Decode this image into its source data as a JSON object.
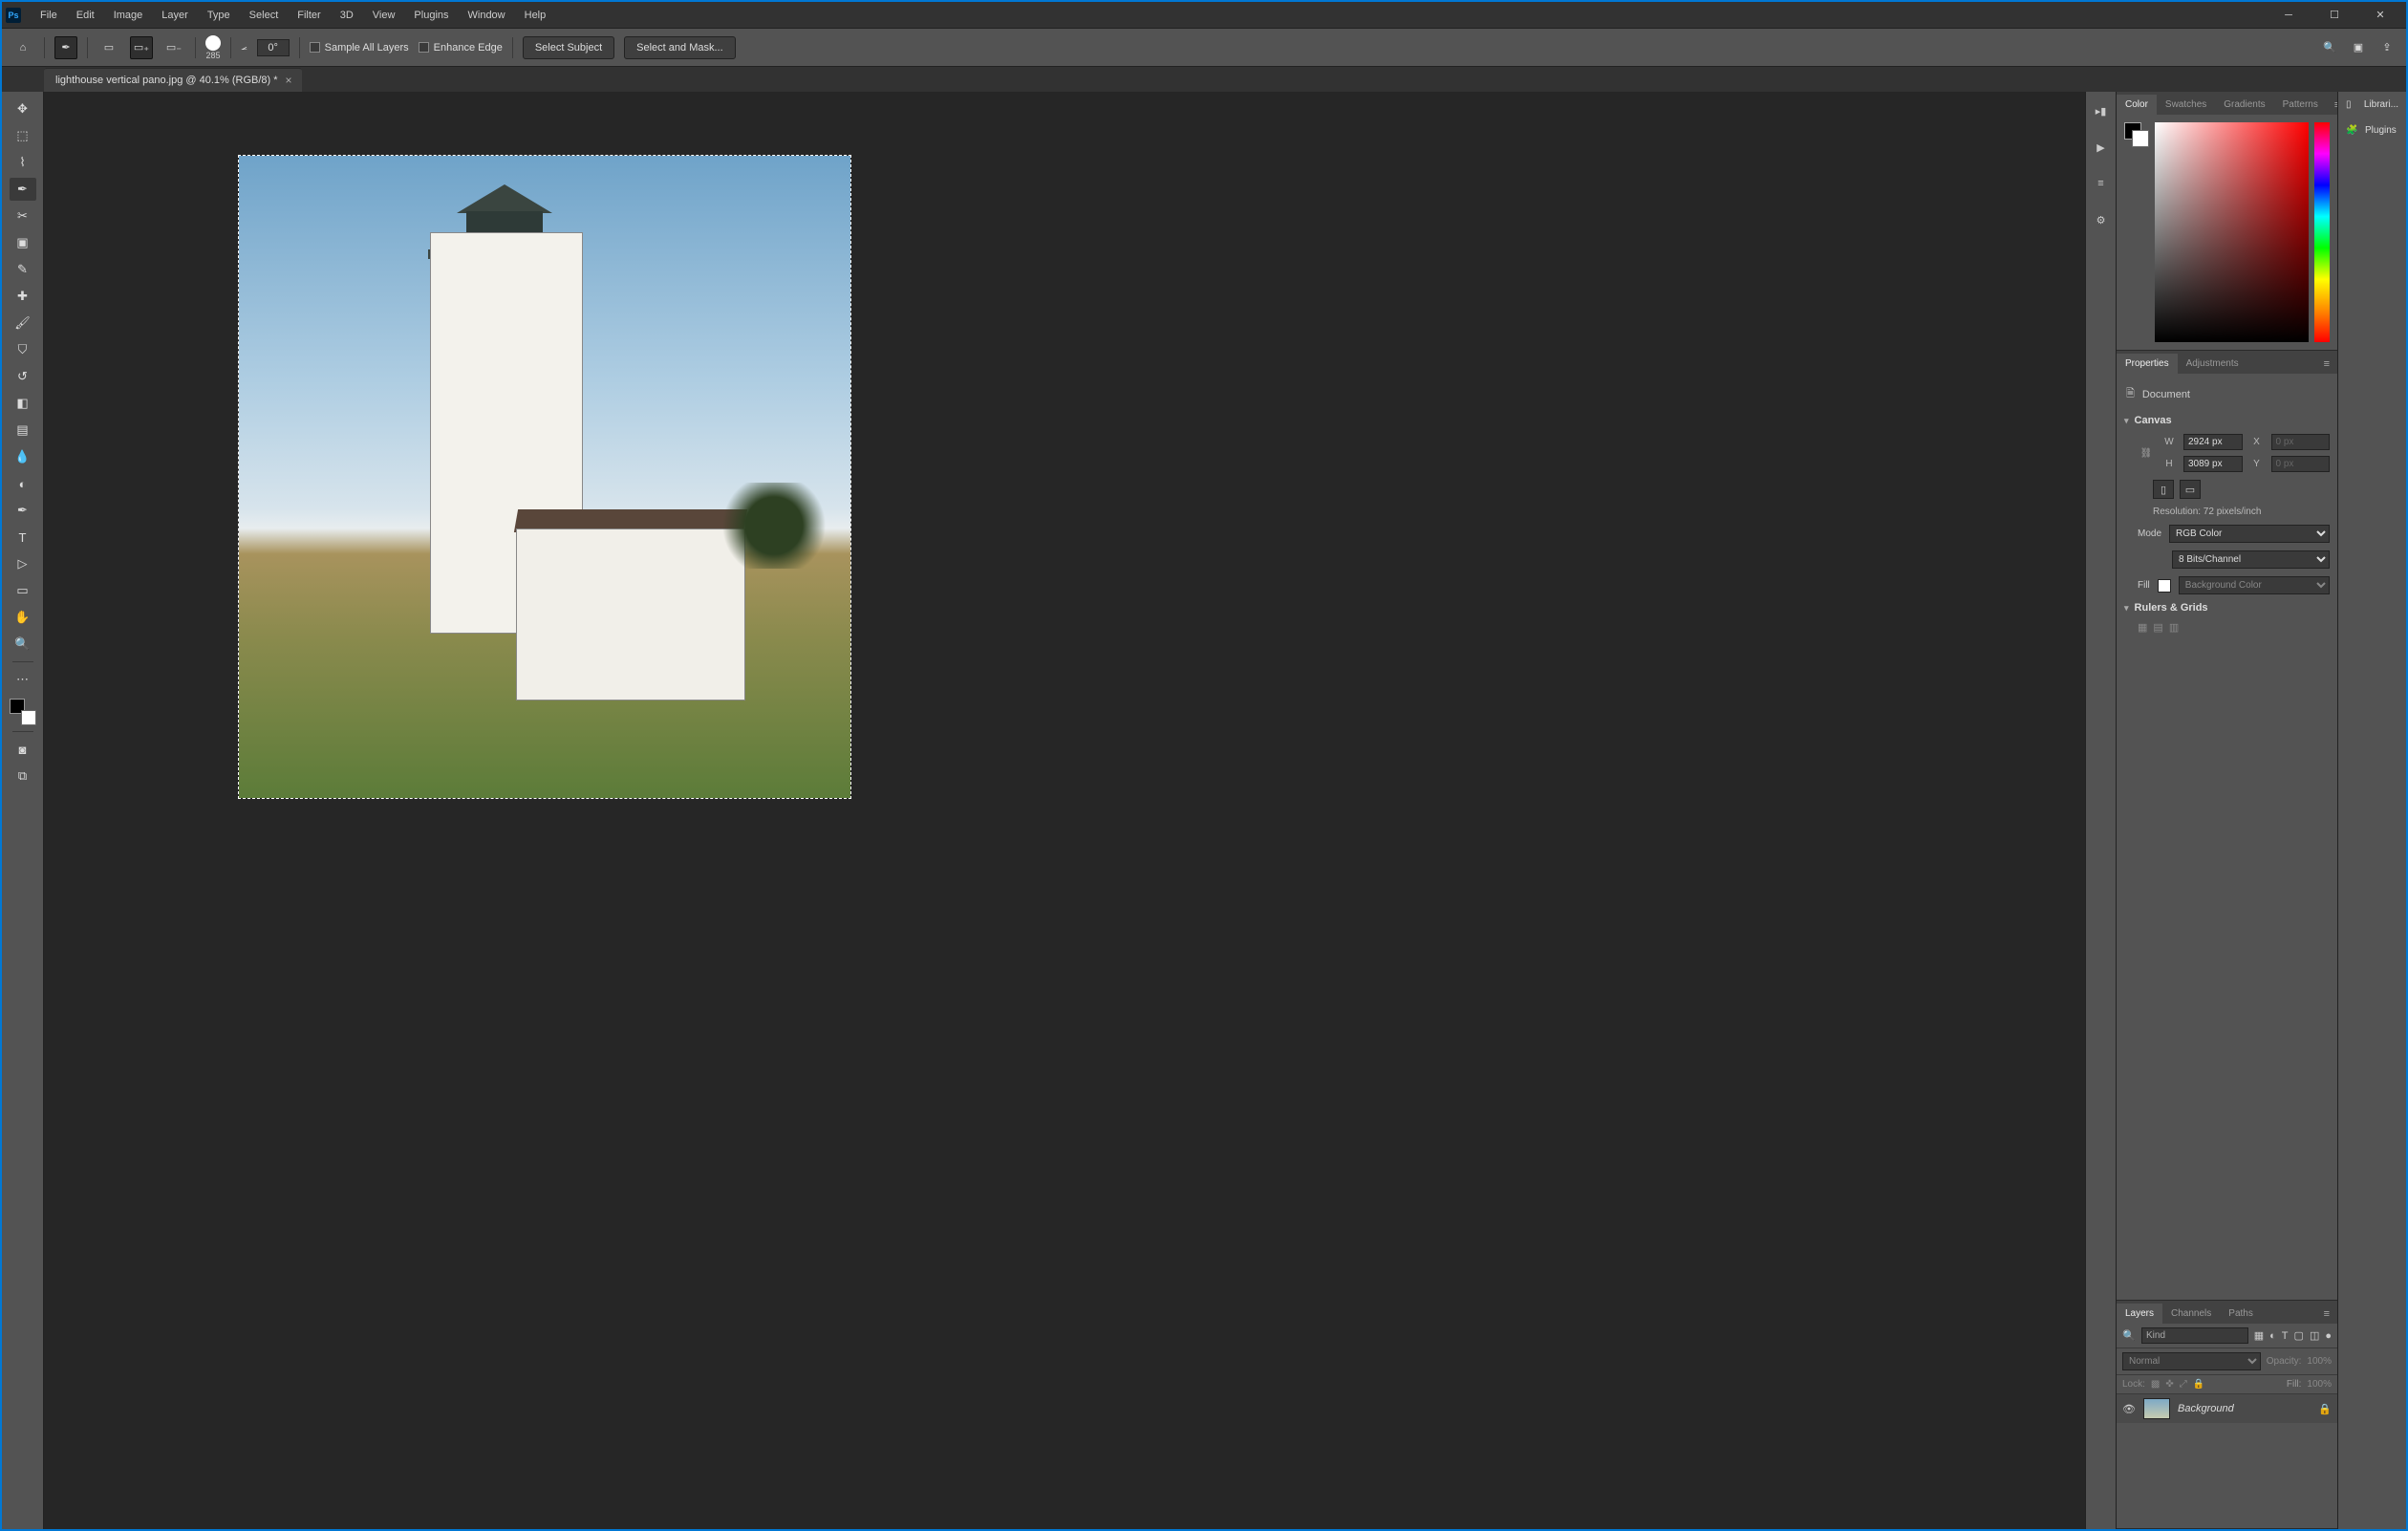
{
  "menu": [
    "File",
    "Edit",
    "Image",
    "Layer",
    "Type",
    "Select",
    "Filter",
    "3D",
    "View",
    "Plugins",
    "Window",
    "Help"
  ],
  "options": {
    "brush_size": "285",
    "angle_label": "0°",
    "sample_all": "Sample All Layers",
    "enhance": "Enhance Edge",
    "select_subject": "Select Subject",
    "select_mask": "Select and Mask..."
  },
  "doc_tab": "lighthouse vertical pano.jpg @ 40.1% (RGB/8) *",
  "panels": {
    "color_tabs": [
      "Color",
      "Swatches",
      "Gradients",
      "Patterns"
    ],
    "props_tabs": [
      "Properties",
      "Adjustments"
    ],
    "props": {
      "doc_label": "Document",
      "canvas": "Canvas",
      "w_label": "W",
      "w": "2924 px",
      "h_label": "H",
      "h": "3089 px",
      "x_label": "X",
      "x": "0 px",
      "y_label": "Y",
      "y": "0 px",
      "resolution": "Resolution: 72 pixels/inch",
      "mode_label": "Mode",
      "mode": "RGB Color",
      "depth": "8 Bits/Channel",
      "fill_label": "Fill",
      "fill": "Background Color",
      "rulers": "Rulers & Grids"
    },
    "layers_tabs": [
      "Layers",
      "Channels",
      "Paths"
    ],
    "layers": {
      "kind": "Kind",
      "blend": "Normal",
      "opacity_label": "Opacity:",
      "opacity": "100%",
      "lock_label": "Lock:",
      "fill_label": "Fill:",
      "fill": "100%",
      "layer_name": "Background"
    }
  },
  "far_right": {
    "libraries": "Librari...",
    "plugins": "Plugins"
  }
}
